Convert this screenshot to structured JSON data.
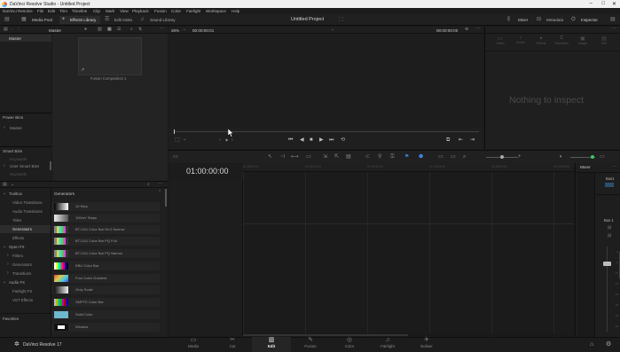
{
  "titlebar": {
    "title": "DaVinci Resolve Studio - Untitled Project"
  },
  "menubar": {
    "items": [
      "DaVinci Resolve",
      "File",
      "Edit",
      "Trim",
      "Timeline",
      "Clip",
      "Mark",
      "View",
      "Playback",
      "Fusion",
      "Color",
      "Fairlight",
      "Workspace",
      "Help"
    ]
  },
  "toolbar": {
    "media_pool": "Media Pool",
    "effects_library": "Effects Library",
    "edit_index": "Edit Index",
    "sound_library": "Sound Library",
    "project_title": "Untitled Project",
    "mixer": "Mixer",
    "metadata": "Metadata",
    "inspector": "Inspector"
  },
  "media_pool": {
    "bin_header": "Master",
    "master_bin": "Master",
    "clip_name": "Fusion Composition 1",
    "power_bins": "Power Bins",
    "power_master": "Master",
    "smart_bins": "Smart Bins",
    "smart_keywords": "Keywords",
    "user_smart_bins": "User Smart Bins",
    "keywords2": "Keywords"
  },
  "viewer": {
    "zoom": "26%",
    "source_tc": "00:00:00:01",
    "end_tc": "00:00:00:00"
  },
  "inspector": {
    "empty_message": "Nothing to inspect",
    "tabs": [
      "Video",
      "Audio",
      "Effects",
      "Transition",
      "Image",
      "File"
    ]
  },
  "timeline": {
    "timecode": "01:00:00:00",
    "ruler": [
      "01:00:00:00",
      "01:00:01:00",
      "01:00:02:00",
      "01:00:03:00",
      "01:00:04:00",
      "01:00:05:00"
    ]
  },
  "mixer": {
    "title": "Mixer",
    "bus1_top": "Bus1",
    "bus1_label": "Bus 1",
    "scale": [
      "0",
      "-5",
      "-10",
      "-15",
      "-20",
      "-30",
      "-40",
      "-50"
    ]
  },
  "effects": {
    "tree": {
      "toolbox": "Toolbox",
      "video_transitions": "Video Transitions",
      "audio_transitions": "Audio Transitions",
      "titles": "Titles",
      "generators": "Generators",
      "effects": "Effects",
      "open_fx": "Open FX",
      "filters": "Filters",
      "ofx_generators": "Generators",
      "transitions": "Transitions",
      "audio_fx": "Audio FX",
      "fairlight_fx": "Fairlight FX",
      "vst_effects": "VST Effects",
      "favorites": "Favorites"
    },
    "generators_header": "Generators",
    "generators": [
      "10 Step",
      "100mV Steps",
      "BT.2111 Color Bar HLG Narrow",
      "BT.2111 Color Bar PQ Full",
      "BT.2111 Color Bar PQ Narrow",
      "EBU Color Bar",
      "Four Color Gradient",
      "Grey Scale",
      "SMPTE Color Bar",
      "Solid Color",
      "Window"
    ]
  },
  "pages": [
    "Media",
    "Cut",
    "Edit",
    "Fusion",
    "Color",
    "Fairlight",
    "Deliver"
  ],
  "footer": {
    "app_name": "DaVinci Resolve 17"
  }
}
